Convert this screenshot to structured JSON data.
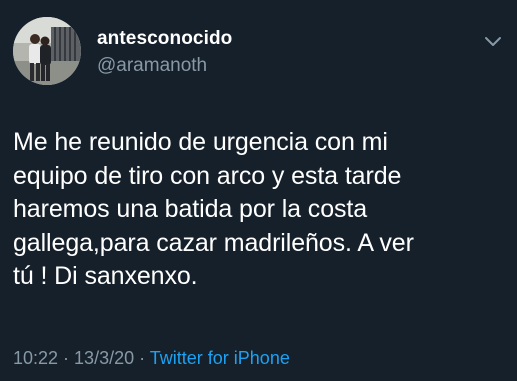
{
  "user": {
    "display_name": "antesconocido",
    "handle": "@aramanoth"
  },
  "tweet": {
    "text": "Me he reunido de urgencia con mi\nequipo de tiro con arco y esta tarde\nharemos una batida por la costa\ngallega,para cazar madrileños. A ver\ntú ! Di sanxenxo.",
    "time": "10:22",
    "separator": " · ",
    "date": "13/3/20",
    "source": "Twitter for iPhone"
  },
  "icons": {
    "caret": "chevron-down-icon"
  },
  "colors": {
    "background": "#15202b",
    "primary_text": "#ffffff",
    "secondary_text": "#8899a6",
    "link": "#1da1f2"
  }
}
